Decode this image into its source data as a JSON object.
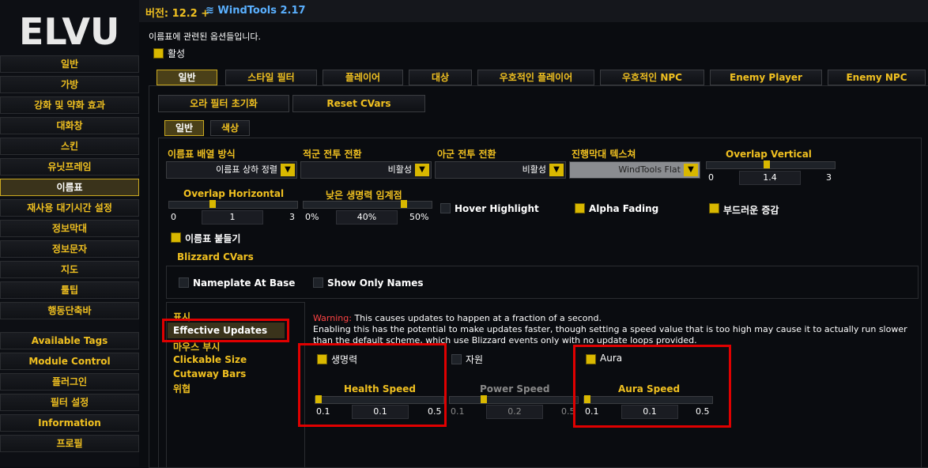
{
  "header": {
    "version": "버전: 12.2 +",
    "windtools": "WindTools 2.17"
  },
  "logo": "ELVUI",
  "sidebar": {
    "items": [
      "일반",
      "가방",
      "강화 및 약화 효과",
      "대화창",
      "스킨",
      "유닛프레임",
      "이름표",
      "재사용 대기시간 설정",
      "정보막대",
      "정보문자",
      "지도",
      "툴팁",
      "행동단축바",
      "Available Tags",
      "Module Control",
      "플러그인",
      "필터 설정",
      "Information",
      "프로필"
    ]
  },
  "main": {
    "description": "이름표에 관련된 옵션들입니다.",
    "enable_label": "활성",
    "tabs": [
      "일반",
      "스타일 필터",
      "플레이어",
      "대상",
      "우호적인 플레이어",
      "우호적인 NPC",
      "Enemy Player",
      "Enemy NPC"
    ],
    "actions": [
      "오라 필터 초기화",
      "Reset CVars"
    ],
    "subtabs": [
      "일반",
      "색상"
    ],
    "dropdowns": [
      {
        "label": "이름표 배열 방식",
        "value": "이름표 상하 정렬"
      },
      {
        "label": "적군 전투 전환",
        "value": "비활성"
      },
      {
        "label": "아군 전투 전환",
        "value": "비활성"
      },
      {
        "label": "진행막대 텍스쳐",
        "value": "WindTools Flat"
      }
    ],
    "overlap_vertical": {
      "label": "Overlap Vertical",
      "min": "0",
      "value": "1.4",
      "max": "3",
      "level": 0.47
    },
    "overlap_horizontal": {
      "label": "Overlap Horizontal",
      "min": "0",
      "value": "1",
      "max": "3",
      "level": 0.33
    },
    "low_health": {
      "label": "낮은 생명력 임계점",
      "min": "0%",
      "value": "40%",
      "max": "50%",
      "level": 0.8
    },
    "hover_highlight": "Hover Highlight",
    "alpha_fading": "Alpha Fading",
    "smooth_bars": "부드러운 증감",
    "clamp_nameplates": "이름표 붙들기",
    "blizzard_cvars": "Blizzard CVars",
    "nameplate_at_base": "Nameplate At Base",
    "show_only_names": "Show Only Names",
    "left_menu": [
      "표시",
      "Effective Updates",
      "마우스 부시",
      "Clickable Size",
      "Cutaway Bars",
      "위협"
    ],
    "warning_prefix": "Warning:",
    "warning_text1": "This causes updates to happen at a fraction of a second.",
    "warning_text2": "Enabling this has the potential to make updates faster, though setting a speed value that is too high may cause it to actually run slower than the default scheme, which use Blizzard events only with no update loops provided.",
    "health": {
      "label": "생명력",
      "speed_label": "Health Speed",
      "min": "0.1",
      "value": "0.1",
      "max": "0.5",
      "level": 0
    },
    "power": {
      "label": "자원",
      "speed_label": "Power Speed",
      "min": "0.1",
      "value": "0.2",
      "max": "0.5",
      "level": 0.25
    },
    "aura": {
      "label": "Aura",
      "speed_label": "Aura Speed",
      "min": "0.1",
      "value": "0.1",
      "max": "0.5",
      "level": 0
    }
  },
  "colors": {
    "accent": "#f0c020",
    "highlight": "#e00000",
    "blue": "#5ab0ff"
  }
}
